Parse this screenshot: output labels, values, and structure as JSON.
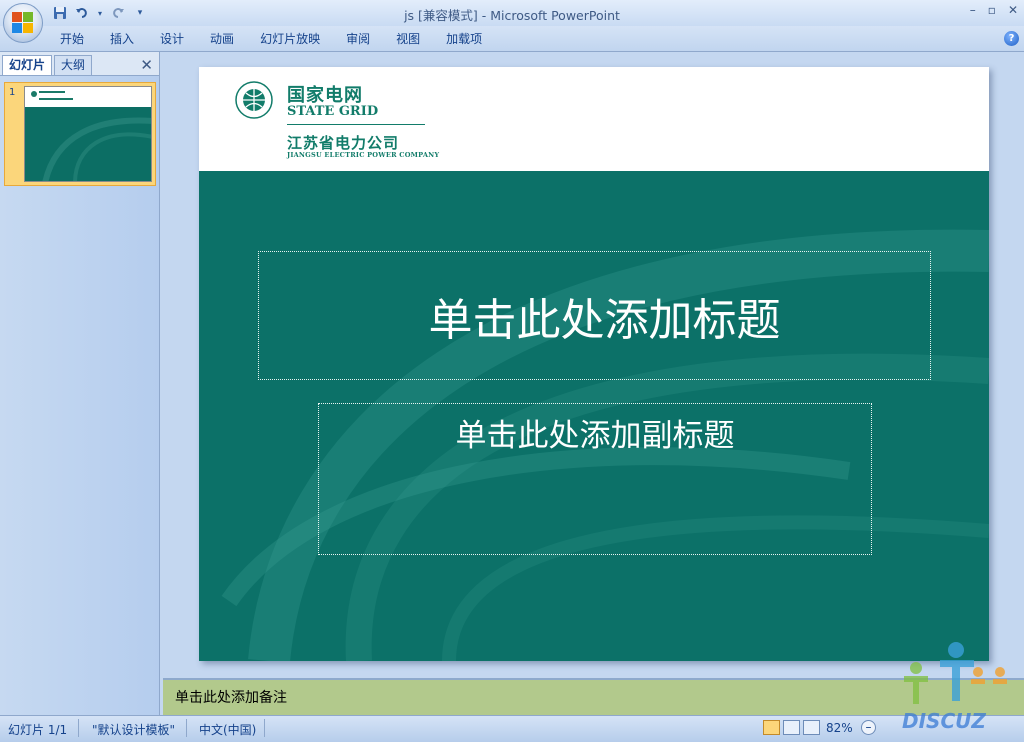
{
  "window": {
    "title": "js [兼容模式] - Microsoft PowerPoint"
  },
  "quick_access": [
    "save-icon",
    "undo-icon",
    "redo-icon",
    "customize-icon"
  ],
  "ribbon": {
    "tabs": [
      "开始",
      "插入",
      "设计",
      "动画",
      "幻灯片放映",
      "审阅",
      "视图",
      "加载项"
    ]
  },
  "left_pane": {
    "tabs": [
      "幻灯片",
      "大纲"
    ],
    "slide_number": "1"
  },
  "slide": {
    "logo": {
      "cn": "国家电网",
      "en": "STATE GRID",
      "cn2": "江苏省电力公司",
      "en2": "JIANGSU ELECTRIC POWER COMPANY"
    },
    "title_placeholder": "单击此处添加标题",
    "subtitle_placeholder": "单击此处添加副标题",
    "colors": {
      "primary": "#0c7168",
      "logo": "#127c6a"
    }
  },
  "notes": {
    "placeholder": "单击此处添加备注"
  },
  "status": {
    "slide_counter": "幻灯片 1/1",
    "template": "\"默认设计模板\"",
    "language": "中文(中国)",
    "zoom": "82%"
  },
  "watermark": "DISCUZ"
}
